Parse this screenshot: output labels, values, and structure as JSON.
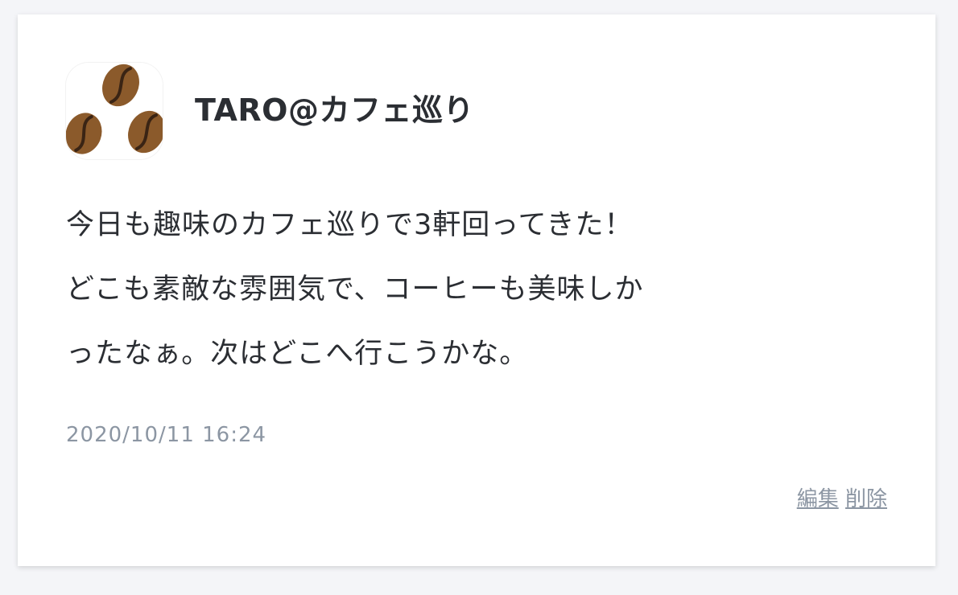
{
  "post": {
    "username": "TARO@カフェ巡り",
    "avatar_icon": "coffee-beans-icon",
    "body_lines": [
      "今日も趣味のカフェ巡りで3軒回ってきた！",
      "どこも素敵な雰囲気で、コーヒーも美味しか",
      "ったなぁ。次はどこへ行こうかな。"
    ],
    "timestamp": "2020/10/11 16:24",
    "actions": {
      "edit_label": "編集",
      "delete_label": "削除"
    }
  },
  "colors": {
    "background": "#f4f5f8",
    "card": "#ffffff",
    "text": "#2b2e33",
    "muted": "#8c96a3",
    "bean": "#8b5a2b",
    "bean_groove": "#3a2414"
  }
}
